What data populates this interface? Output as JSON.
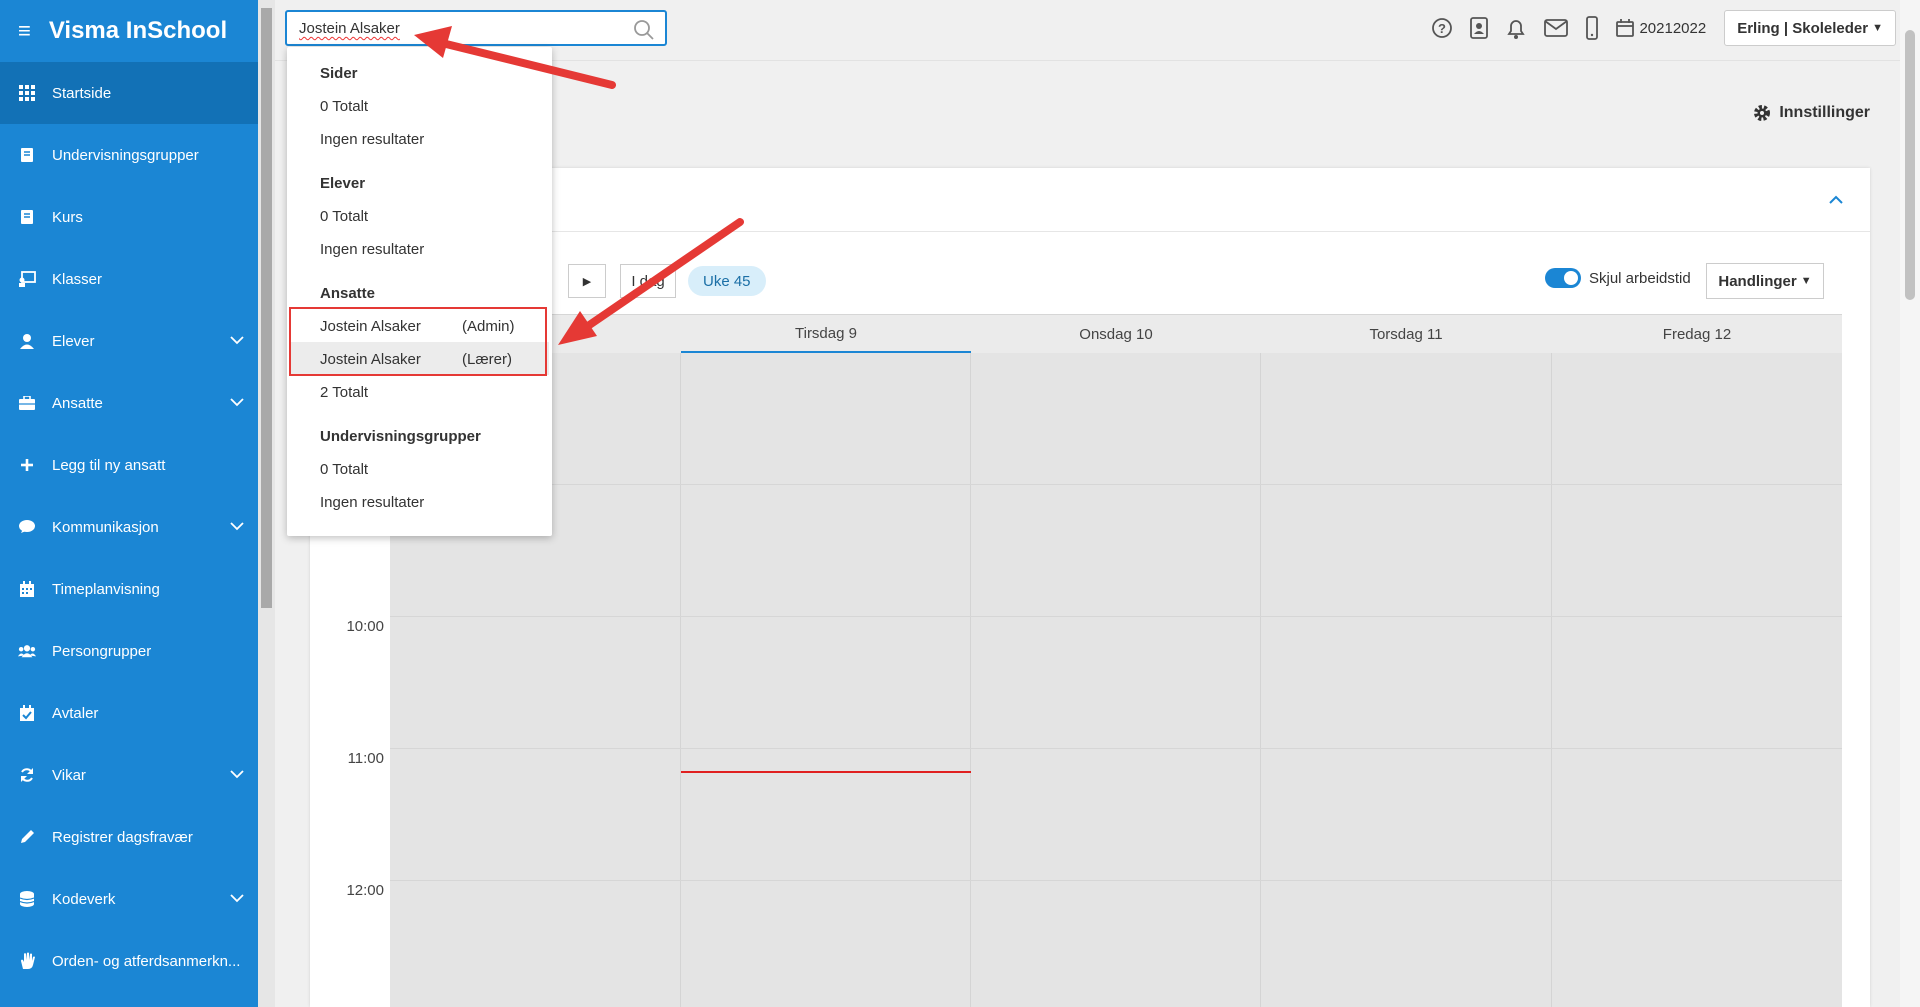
{
  "app": {
    "title": "Visma InSchool"
  },
  "sidebar": {
    "items": [
      {
        "label": "Startside",
        "icon": "grid-icon",
        "active": true,
        "expandable": false
      },
      {
        "label": "Undervisningsgrupper",
        "icon": "book-icon",
        "active": false,
        "expandable": false
      },
      {
        "label": "Kurs",
        "icon": "book-icon",
        "active": false,
        "expandable": false
      },
      {
        "label": "Klasser",
        "icon": "classroom-icon",
        "active": false,
        "expandable": false
      },
      {
        "label": "Elever",
        "icon": "student-icon",
        "active": false,
        "expandable": true
      },
      {
        "label": "Ansatte",
        "icon": "briefcase-icon",
        "active": false,
        "expandable": true
      },
      {
        "label": "Legg til ny ansatt",
        "icon": "plus-icon",
        "active": false,
        "expandable": false
      },
      {
        "label": "Kommunikasjon",
        "icon": "chat-icon",
        "active": false,
        "expandable": true
      },
      {
        "label": "Timeplanvisning",
        "icon": "calendar-icon",
        "active": false,
        "expandable": false
      },
      {
        "label": "Persongrupper",
        "icon": "people-icon",
        "active": false,
        "expandable": false
      },
      {
        "label": "Avtaler",
        "icon": "calendar-check-icon",
        "active": false,
        "expandable": false
      },
      {
        "label": "Vikar",
        "icon": "refresh-icon",
        "active": false,
        "expandable": true
      },
      {
        "label": "Registrer dagsfravær",
        "icon": "pencil-icon",
        "active": false,
        "expandable": false
      },
      {
        "label": "Kodeverk",
        "icon": "database-icon",
        "active": false,
        "expandable": true
      },
      {
        "label": "Orden- og atferdsanmerkn...",
        "icon": "hand-icon",
        "active": false,
        "expandable": false
      }
    ]
  },
  "topbar": {
    "search_value": "Jostein Alsaker",
    "school_year": "20212022",
    "user": "Erling | Skoleleder"
  },
  "search_results": {
    "sections": [
      {
        "title": "Sider",
        "total": "0 Totalt",
        "empty": "Ingen resultater",
        "results": []
      },
      {
        "title": "Elever",
        "total": "0 Totalt",
        "empty": "Ingen resultater",
        "results": []
      },
      {
        "title": "Ansatte",
        "total": "2 Totalt",
        "empty": "",
        "results": [
          {
            "name": "Jostein Alsaker",
            "role": "(Admin)"
          },
          {
            "name": "Jostein Alsaker",
            "role": "(Lærer)"
          }
        ]
      },
      {
        "title": "Undervisningsgrupper",
        "total": "0 Totalt",
        "empty": "Ingen resultater",
        "results": []
      }
    ]
  },
  "settings_label": "Innstillinger",
  "calendar": {
    "today_label": "I dag",
    "week_label": "Uke 45",
    "hide_worktime_label": "Skjul arbeidstid",
    "hide_worktime_on": true,
    "actions_label": "Handlinger",
    "days": [
      "Tirsdag 9",
      "Onsdag 10",
      "Torsdag 11",
      "Fredag 12"
    ],
    "times": [
      "10:00",
      "11:00",
      "12:00"
    ]
  },
  "colors": {
    "sidebar": "#1b86d4",
    "sidebar_active": "#1271b6",
    "accent": "#1b86d4",
    "annotation_red": "#e53935",
    "current_time_line": "#e02020",
    "week_badge_bg": "#d8eefa"
  }
}
